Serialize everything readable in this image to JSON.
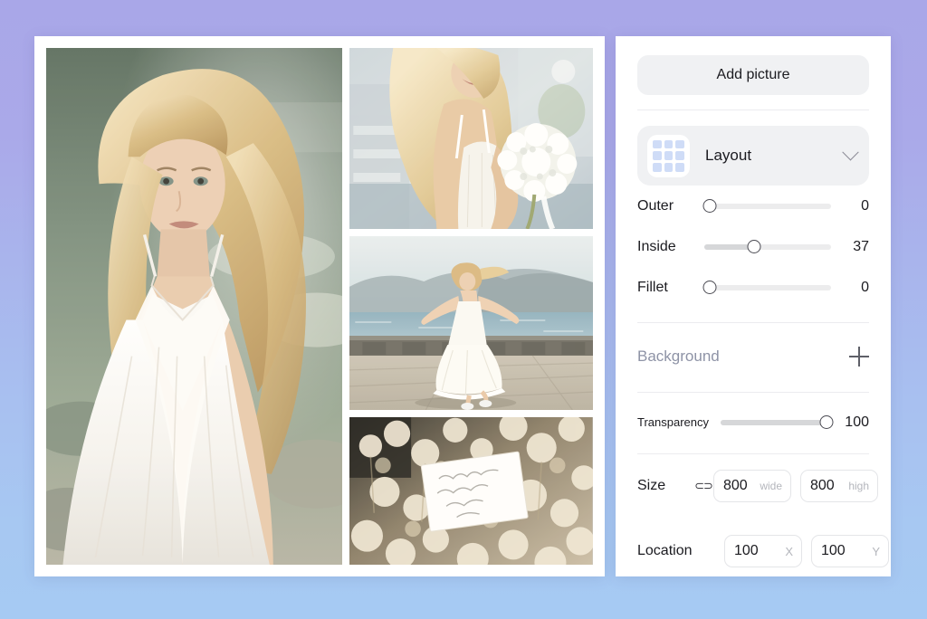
{
  "theme": {
    "background_gradient_top": "#a9a7e8",
    "background_gradient_bottom": "#a6caf3",
    "card_background": "#ffffff",
    "control_background": "#f0f1f3",
    "accent_tile": "#cfdcf7",
    "muted_text": "#8e93a6"
  },
  "canvas": {
    "name": "collage-canvas",
    "photos": [
      {
        "id": "photo-main",
        "alt": "Blonde woman in white dress by the water"
      },
      {
        "id": "photo-tile-1",
        "alt": "Bride from behind holding baby's breath bouquet"
      },
      {
        "id": "photo-tile-2",
        "alt": "Woman in white dress twirling on seaside promenade"
      },
      {
        "id": "photo-tile-3",
        "alt": "Handwritten note card among dried white flowers"
      }
    ]
  },
  "panel": {
    "add_picture_label": "Add picture",
    "layout": {
      "label": "Layout",
      "icon": "grid-3x3-icon",
      "chevron": "chevron-down-icon"
    },
    "sliders": [
      {
        "key": "outer",
        "label": "Outer",
        "value": 0,
        "percent": 0
      },
      {
        "key": "inside",
        "label": "Inside",
        "value": 37,
        "percent": 37
      },
      {
        "key": "fillet",
        "label": "Fillet",
        "value": 0,
        "percent": 0
      }
    ],
    "background": {
      "label": "Background",
      "add_icon": "plus-icon"
    },
    "transparency": {
      "label": "Transparency",
      "value": 100,
      "percent": 100
    },
    "size": {
      "label": "Size",
      "link_icon": "broken-link-icon",
      "width": {
        "value": "800",
        "unit": "wide"
      },
      "height": {
        "value": "800",
        "unit": "high"
      }
    },
    "location": {
      "label": "Location",
      "x": {
        "value": "100",
        "unit": "X"
      },
      "y": {
        "value": "100",
        "unit": "Y"
      }
    }
  }
}
